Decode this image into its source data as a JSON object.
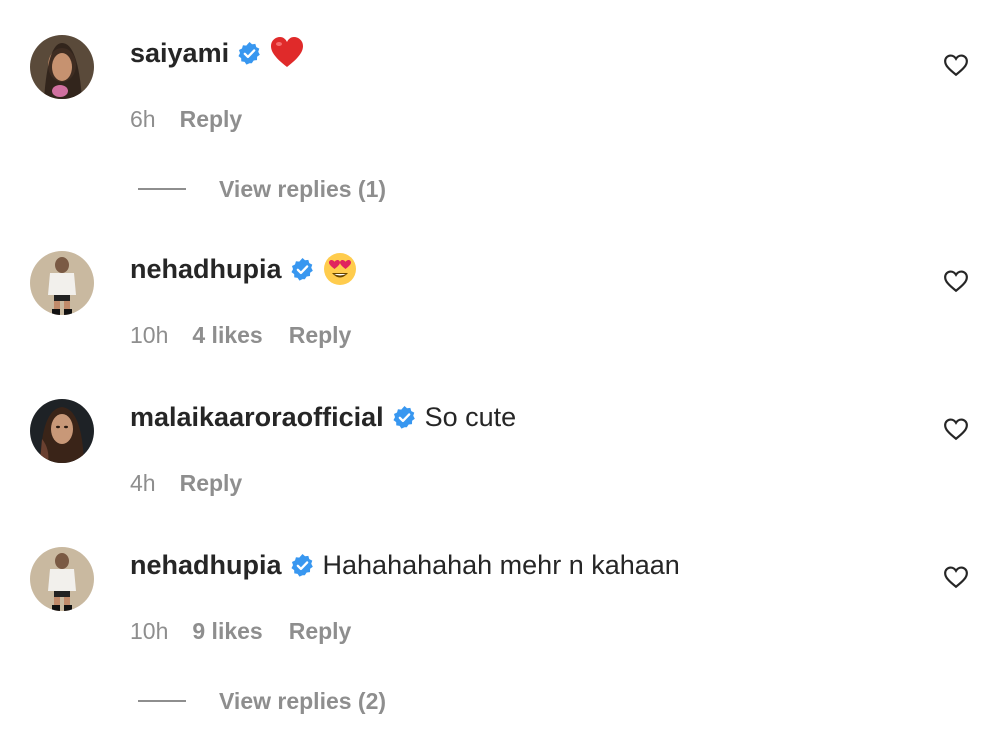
{
  "comments": [
    {
      "username": "saiyami",
      "verified": true,
      "emoji": "red-heart",
      "text": "",
      "time": "6h",
      "likes": "",
      "reply_label": "Reply",
      "view_replies": "View replies (1)"
    },
    {
      "username": "nehadhupia",
      "verified": true,
      "emoji": "heart-eyes",
      "text": "",
      "time": "10h",
      "likes": "4 likes",
      "reply_label": "Reply",
      "view_replies": ""
    },
    {
      "username": "malaikaaroraofficial",
      "verified": true,
      "emoji": "",
      "text": "So cute",
      "time": "4h",
      "likes": "",
      "reply_label": "Reply",
      "view_replies": ""
    },
    {
      "username": "nehadhupia",
      "verified": true,
      "emoji": "",
      "text": "Hahahahahah mehr n kahaan",
      "time": "10h",
      "likes": "9 likes",
      "reply_label": "Reply",
      "view_replies": "View replies (2)"
    }
  ],
  "colors": {
    "text": "#262626",
    "secondary": "#8e8e8e",
    "verified": "#3897f0"
  }
}
